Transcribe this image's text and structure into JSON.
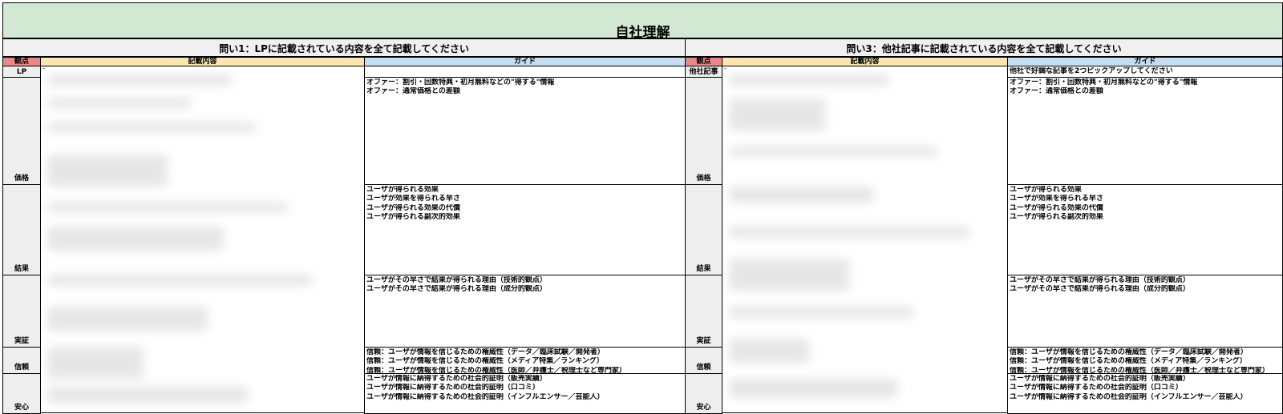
{
  "sheet": {
    "title": "自社理解",
    "q1": {
      "heading": "問い1：LPに記載されている内容を全て記載してください",
      "col_label": "観点",
      "col_content": "記載内容",
      "col_guide": "ガイド",
      "first_row_label": "LP"
    },
    "q3": {
      "heading": "問い3：他社記事に記載されている内容を全て記載してください",
      "col_label": "観点",
      "col_content": "記載内容",
      "col_guide": "ガイド",
      "first_row_label": "他社記事",
      "first_row_guide": "他社で好調な記事を2つピックアップしてください"
    },
    "rows": [
      {
        "label": "価格",
        "guide": [
          "オファー：割引・回数特典・初月無料などの\"得する\"情報",
          "オファー：通常価格との差額"
        ]
      },
      {
        "label": "結果",
        "guide": [
          "ユーザが得られる効果",
          "ユーザが効果を得られる早さ",
          "ユーザが得られる効果の代償",
          "ユーザが得られる副次的効果"
        ]
      },
      {
        "label": "実証",
        "guide": [
          "ユーザがその早さで結果が得られる理由（技術的観点）",
          "ユーザがその早さで結果が得られる理由（成分的観点）"
        ]
      },
      {
        "label": "信頼",
        "guide": [
          "信頼：ユーザが情報を信じるための権威性（データ／臨床試験／開発者）",
          "信頼：ユーザが情報を信じるための権威性（メディア特集／ランキング）",
          "信頼：ユーザが情報を信じるための権威性（医師／弁護士／税理士など専門家）"
        ]
      },
      {
        "label": "安心",
        "guide": [
          "ユーザが情報に納得するための社会的証明（販売実績）",
          "ユーザが情報に納得するための社会的証明（口コミ）",
          "ユーザが情報に納得するための社会的証明（インフルエンサー／芸能人）"
        ]
      }
    ]
  }
}
